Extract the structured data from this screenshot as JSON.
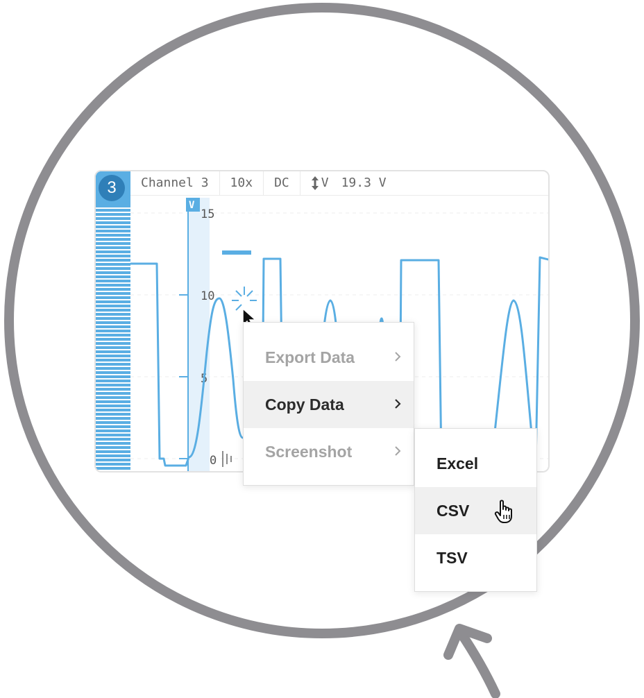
{
  "channel": {
    "number": "3",
    "name": "Channel 3",
    "probe": "10x",
    "coupling": "DC",
    "range_value": "19.3 V",
    "axis_unit": "V"
  },
  "axis": {
    "ticks": [
      "15",
      "10",
      "5",
      "0"
    ]
  },
  "icons": {
    "range": "vertical-range-icon",
    "ground": "ground-marker-icon",
    "pointer": "mouse-pointer-icon",
    "hand": "hand-pointer-icon",
    "chevron": "chevron-right-icon",
    "arrow": "curved-arrow-icon"
  },
  "colors": {
    "accent": "#5aaee3",
    "badge": "#2f7fb8",
    "ring": "#8e8d91"
  },
  "context_menu": {
    "items": [
      {
        "label": "Export Data",
        "state": "disabled"
      },
      {
        "label": "Copy Data",
        "state": "active"
      },
      {
        "label": "Screenshot",
        "state": "disabled"
      }
    ]
  },
  "submenu": {
    "items": [
      {
        "label": "Excel"
      },
      {
        "label": "CSV",
        "state": "hover"
      },
      {
        "label": "TSV"
      }
    ]
  }
}
